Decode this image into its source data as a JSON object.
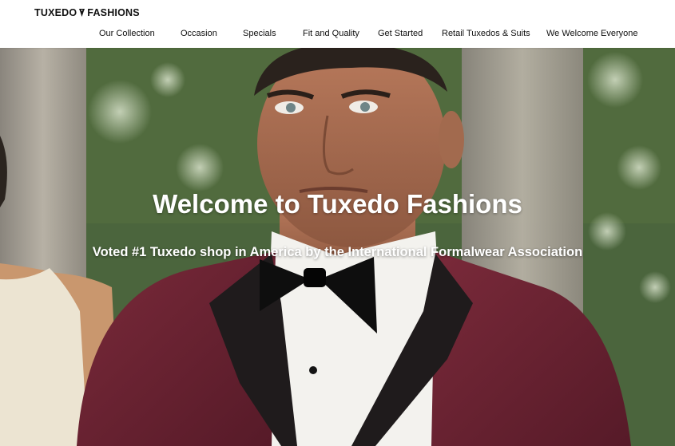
{
  "brand": {
    "name_left": "TUXEDO",
    "name_right": "FASHIONS",
    "logo_icon": "bowtie-badge-icon"
  },
  "nav": {
    "items": [
      {
        "label": "Our Collection"
      },
      {
        "label": "Occasion"
      },
      {
        "label": "Specials"
      },
      {
        "label": "Fit and Quality"
      },
      {
        "label": "Get Started"
      },
      {
        "label": "Retail Tuxedos & Suits"
      },
      {
        "label": "We Welcome Everyone"
      }
    ]
  },
  "hero": {
    "title": "Welcome to Tuxedo Fashions",
    "subtitle": "Voted #1 Tuxedo shop in America by the International Formalwear Association",
    "image_subject": "man-in-burgundy-tuxedo-photo"
  },
  "colors": {
    "header_bg": "#ffffff",
    "text_dark": "#111111",
    "hero_text": "#ffffff",
    "jacket_burgundy": "#6a2232",
    "foliage_green": "#4e6a3f"
  }
}
